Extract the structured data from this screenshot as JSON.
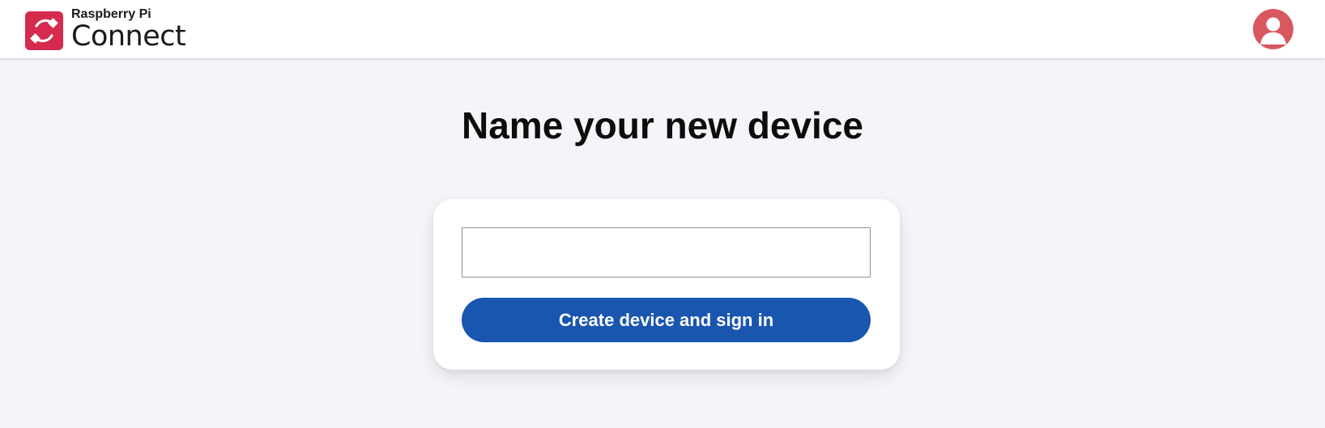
{
  "header": {
    "brand_top": "Raspberry Pi",
    "brand_bottom": "Connect",
    "brand_color": "#d62a4e",
    "avatar_color": "#d9575f",
    "logo_icon": "connect-logo-icon",
    "avatar_icon": "user-avatar-icon"
  },
  "main": {
    "title": "Name your new device",
    "device_name_input": {
      "value": "",
      "placeholder": ""
    },
    "submit_label": "Create device and sign in",
    "submit_color": "#1956b0"
  }
}
